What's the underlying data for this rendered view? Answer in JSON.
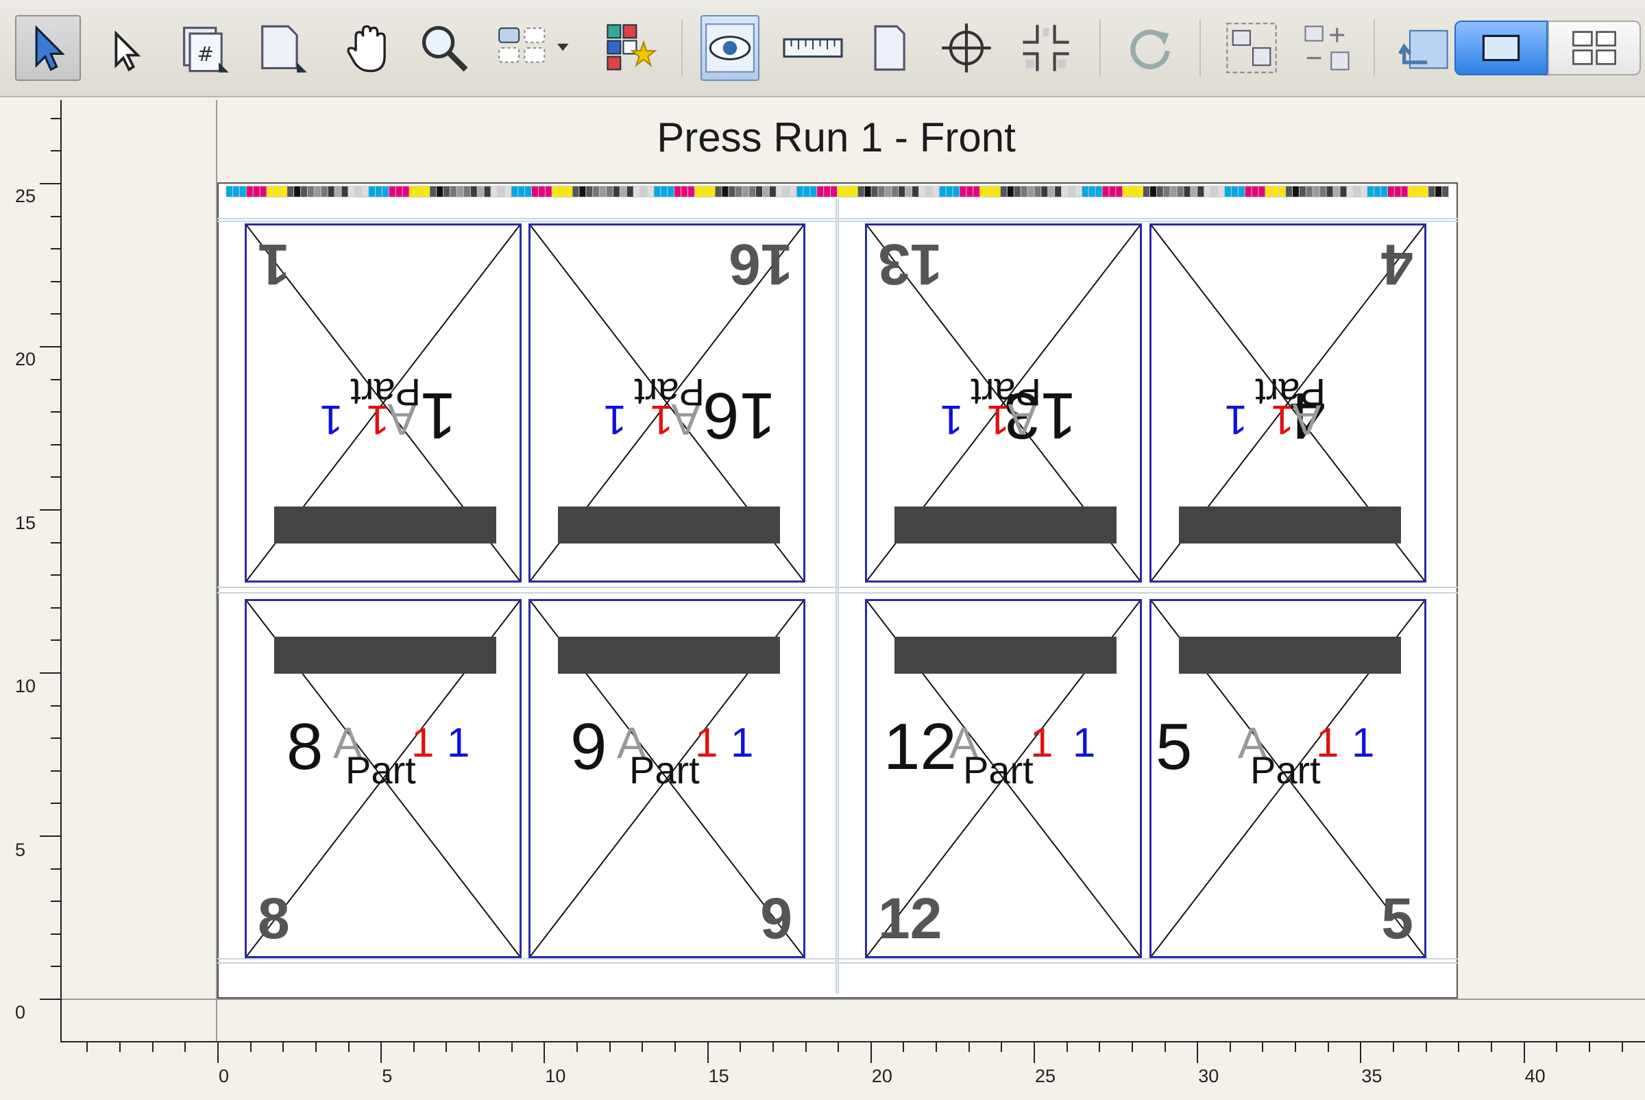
{
  "toolbar": {
    "tools": [
      {
        "name": "select-arrow-icon",
        "selected": true
      },
      {
        "name": "subselect-arrow-icon",
        "selected": false
      },
      {
        "name": "page-number-tool-icon",
        "selected": false
      },
      {
        "name": "page-tool-icon",
        "selected": false
      },
      {
        "name": "hand-pan-icon",
        "selected": false
      },
      {
        "name": "zoom-magnifier-icon",
        "selected": false
      },
      {
        "name": "layout-grid-dropdown-icon",
        "selected": false
      },
      {
        "name": "auto-layout-wand-icon",
        "selected": false
      },
      {
        "name": "preview-eye-icon",
        "selected": true
      },
      {
        "name": "ruler-measure-icon",
        "selected": false
      },
      {
        "name": "sheet-page-icon",
        "selected": false
      },
      {
        "name": "crosshair-register-icon",
        "selected": false
      },
      {
        "name": "crop-marks-icon",
        "selected": false
      },
      {
        "name": "rotate-redo-icon",
        "selected": false
      },
      {
        "name": "marquee-select-icon",
        "selected": false
      },
      {
        "name": "align-snap-icon",
        "selected": false
      },
      {
        "name": "back-undo-icon",
        "selected": false
      }
    ],
    "view_modes": [
      {
        "name": "single-view-icon",
        "active": true
      },
      {
        "name": "grid-view-icon",
        "active": false
      }
    ],
    "accent_color": "#2f7fe6"
  },
  "canvas": {
    "title": "Press Run 1 - Front",
    "vertical_ruler_labels": [
      "25",
      "20",
      "15",
      "10",
      "5",
      "0"
    ],
    "horizontal_ruler_labels": [
      "0",
      "5",
      "10",
      "15",
      "20",
      "25",
      "30",
      "35",
      "40"
    ]
  },
  "pages": [
    {
      "number": "1",
      "part": "Part",
      "a": "A",
      "red": "1",
      "blue": "1",
      "flipped": true
    },
    {
      "number": "16",
      "part": "Part",
      "a": "A",
      "red": "1",
      "blue": "1",
      "flipped": true
    },
    {
      "number": "13",
      "part": "Part",
      "a": "A",
      "red": "1",
      "blue": "1",
      "flipped": true
    },
    {
      "number": "4",
      "part": "Part",
      "a": "A",
      "red": "1",
      "blue": "1",
      "flipped": true
    },
    {
      "number": "8",
      "part": "Part",
      "a": "A",
      "red": "1",
      "blue": "1",
      "flipped": false
    },
    {
      "number": "9",
      "part": "Part",
      "a": "A",
      "red": "1",
      "blue": "1",
      "flipped": false
    },
    {
      "number": "12",
      "part": "Part",
      "a": "A",
      "red": "1",
      "blue": "1",
      "flipped": false
    },
    {
      "number": "5",
      "part": "Part",
      "a": "A",
      "red": "1",
      "blue": "1",
      "flipped": false
    }
  ],
  "colors": {
    "page_border": "#2a2aa6",
    "red_mark": "#e01010",
    "blue_mark": "#1010dd"
  }
}
